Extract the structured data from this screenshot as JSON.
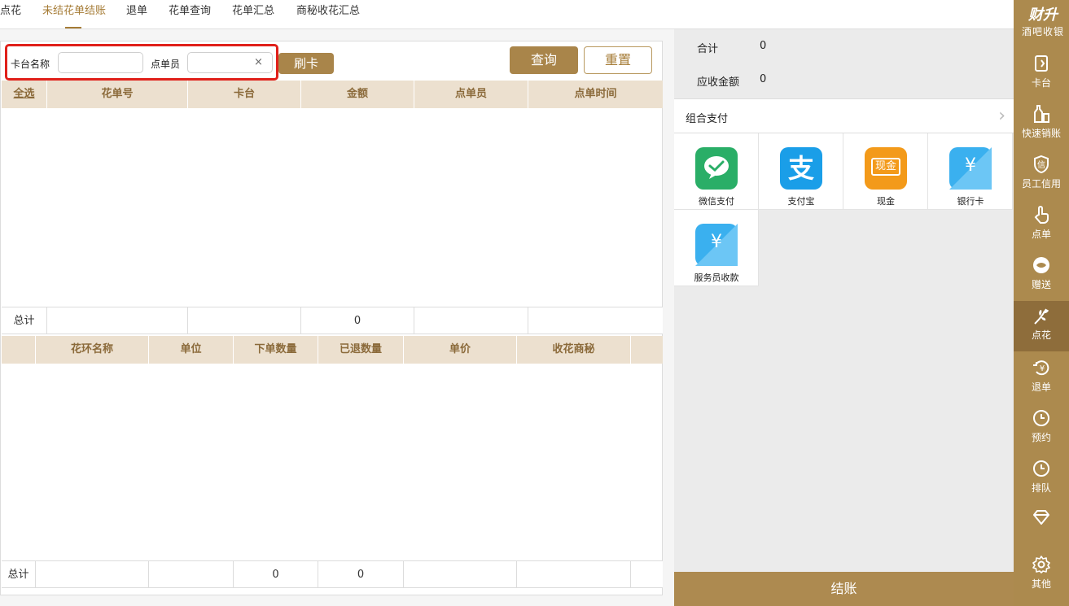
{
  "top_tabs": [
    "点花",
    "未结花单结账",
    "退单",
    "花单查询",
    "花单汇总",
    "商秘收花汇总"
  ],
  "filter": {
    "table_label": "卡台名称",
    "table_value": "",
    "staff_label": "点单员",
    "staff_value": "",
    "clear_symbol": "×",
    "swipe_label": "刷卡",
    "query_label": "查询",
    "reset_label": "重置"
  },
  "orders_table": {
    "columns": [
      "全选",
      "花单号",
      "卡台",
      "金额",
      "点单员",
      "点单时间"
    ],
    "rows": [],
    "total_label": "总计",
    "total_amount": "0"
  },
  "items_table": {
    "columns": [
      "",
      "花环名称",
      "单位",
      "下单数量",
      "已退数量",
      "单价",
      "收花商秘",
      ""
    ],
    "rows": [],
    "total_label": "总计",
    "total_ordered": "0",
    "total_returned": "0"
  },
  "payment": {
    "total_label": "合计",
    "total_value": "0",
    "receivable_label": "应收金额",
    "receivable_value": "0",
    "combo_label": "组合支付",
    "methods": [
      {
        "label": "微信支付",
        "icon": "wechat-pay-icon",
        "color": "#2aae67"
      },
      {
        "label": "支付宝",
        "icon": "alipay-icon",
        "color": "#1a9ee8"
      },
      {
        "label": "现金",
        "icon": "cash-icon",
        "color": "#f39a1a",
        "icon_text": "现金"
      },
      {
        "label": "银行卡",
        "icon": "bank-card-icon",
        "color": "#3ab0ef",
        "icon_text": "¥"
      },
      {
        "label": "服务员收款",
        "icon": "waiter-payment-icon",
        "color": "#3ab0ef",
        "icon_text": "¥"
      }
    ],
    "checkout_label": "结账"
  },
  "sidebar": {
    "brand": "财升",
    "subtitle": "酒吧收银",
    "items": [
      {
        "label": "卡台",
        "icon": "table-icon"
      },
      {
        "label": "快速销账",
        "icon": "quick-writeoff-icon"
      },
      {
        "label": "员工信用",
        "icon": "staff-credit-icon"
      },
      {
        "label": "点单",
        "icon": "order-icon"
      },
      {
        "label": "赠送",
        "icon": "gift-icon"
      },
      {
        "label": "点花",
        "icon": "flower-icon"
      },
      {
        "label": "退单",
        "icon": "refund-icon"
      },
      {
        "label": "预约",
        "icon": "reservation-icon"
      },
      {
        "label": "排队",
        "icon": "queue-icon"
      },
      {
        "label": "",
        "icon": "diamond-icon"
      },
      {
        "label": "其他",
        "icon": "settings-icon"
      }
    ]
  },
  "colors": {
    "gold": "#ac8a4e",
    "header_bg": "#ece0cf",
    "highlight": "#e0201a"
  }
}
